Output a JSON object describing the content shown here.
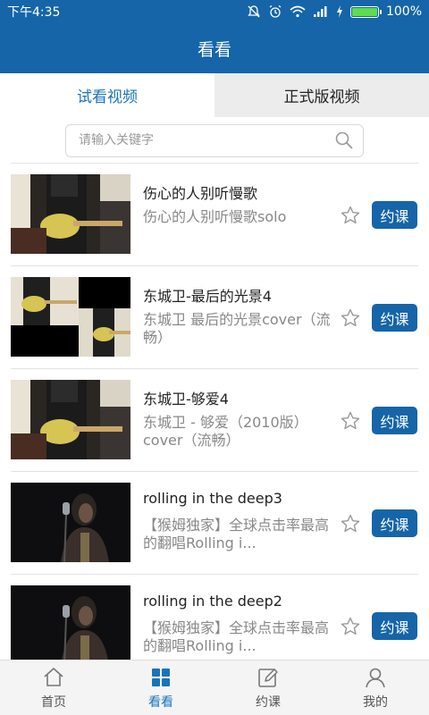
{
  "status_bar": {
    "time": "下午4:35",
    "battery": "100%",
    "battery_level": 1.0
  },
  "header": {
    "title": "看看"
  },
  "tabs": [
    {
      "label": "试看视频",
      "active": true
    },
    {
      "label": "正式版视频",
      "active": false
    }
  ],
  "search": {
    "placeholder": "请输入关键字",
    "value": ""
  },
  "videos": [
    {
      "title": "伤心的人别听慢歌",
      "description": "伤心的人别听慢歌solo",
      "button": "约课",
      "thumb": "guitar"
    },
    {
      "title": "东城卫-最后的光景4",
      "description": "东城卫 最后的光景cover（流畅）",
      "button": "约课",
      "thumb": "guitar-split"
    },
    {
      "title": "东城卫-够爱4",
      "description": "东城卫 - 够爱（2010版）cover（流畅）",
      "button": "约课",
      "thumb": "guitar"
    },
    {
      "title": "rolling in the deep3",
      "description": "【猴姆独家】全球点击率最高的翻唱Rolling i...",
      "button": "约课",
      "thumb": "singer"
    },
    {
      "title": "rolling in the deep2",
      "description": "【猴姆独家】全球点击率最高的翻唱Rolling i...",
      "button": "约课",
      "thumb": "singer"
    }
  ],
  "bottom_nav": [
    {
      "label": "首页",
      "icon": "home-icon",
      "active": false
    },
    {
      "label": "看看",
      "icon": "grid-icon",
      "active": true
    },
    {
      "label": "约课",
      "icon": "edit-icon",
      "active": false
    },
    {
      "label": "我的",
      "icon": "user-icon",
      "active": false
    }
  ],
  "colors": {
    "primary": "#1565a8",
    "accent_text": "#1a73b8",
    "muted_text": "#888888"
  }
}
